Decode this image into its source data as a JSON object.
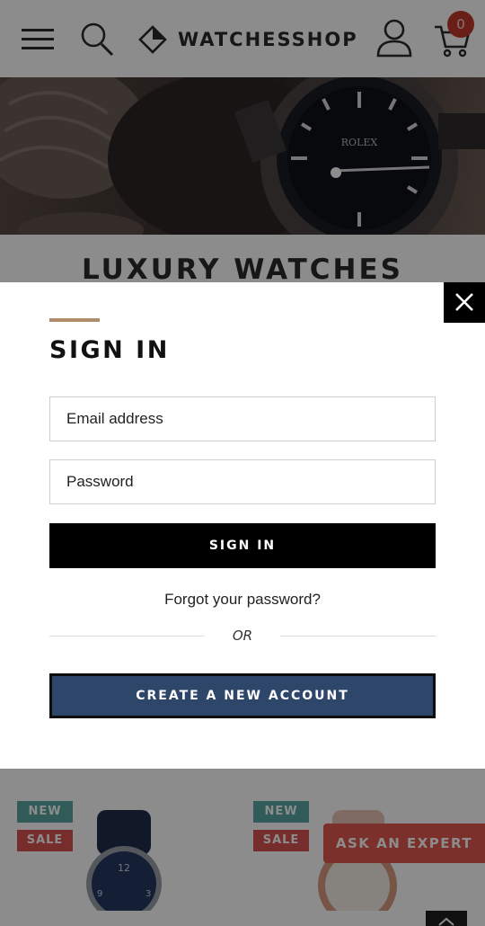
{
  "header": {
    "logo_text": "WATCHESSHOP",
    "cart_count": "0",
    "icons": [
      "menu-icon",
      "search-icon",
      "logo-diamond-icon",
      "user-icon",
      "cart-icon"
    ]
  },
  "hero": {
    "heading": "LUXURY WATCHES"
  },
  "modal": {
    "title": "SIGN IN",
    "email_placeholder": "Email address",
    "password_placeholder": "Password",
    "signin_label": "SIGN IN",
    "forgot_label": "Forgot your password?",
    "or_label": "OR",
    "create_label": "CREATE A NEW ACCOUNT",
    "close_icon": "close-icon"
  },
  "products": {
    "items": [
      {
        "badge_new": "NEW",
        "badge_sale": "SALE"
      },
      {
        "badge_new": "NEW",
        "badge_sale": "SALE"
      }
    ]
  },
  "ask_expert_label": "ASK AN EXPERT",
  "colors": {
    "accent": "#b08d6a",
    "primary_button": "#000000",
    "create_button": "#2d466a",
    "badge_new": "#5aa6a3",
    "badge_sale": "#d9534f",
    "cart_badge": "#c0392b",
    "ask_expert": "#e0584f"
  }
}
